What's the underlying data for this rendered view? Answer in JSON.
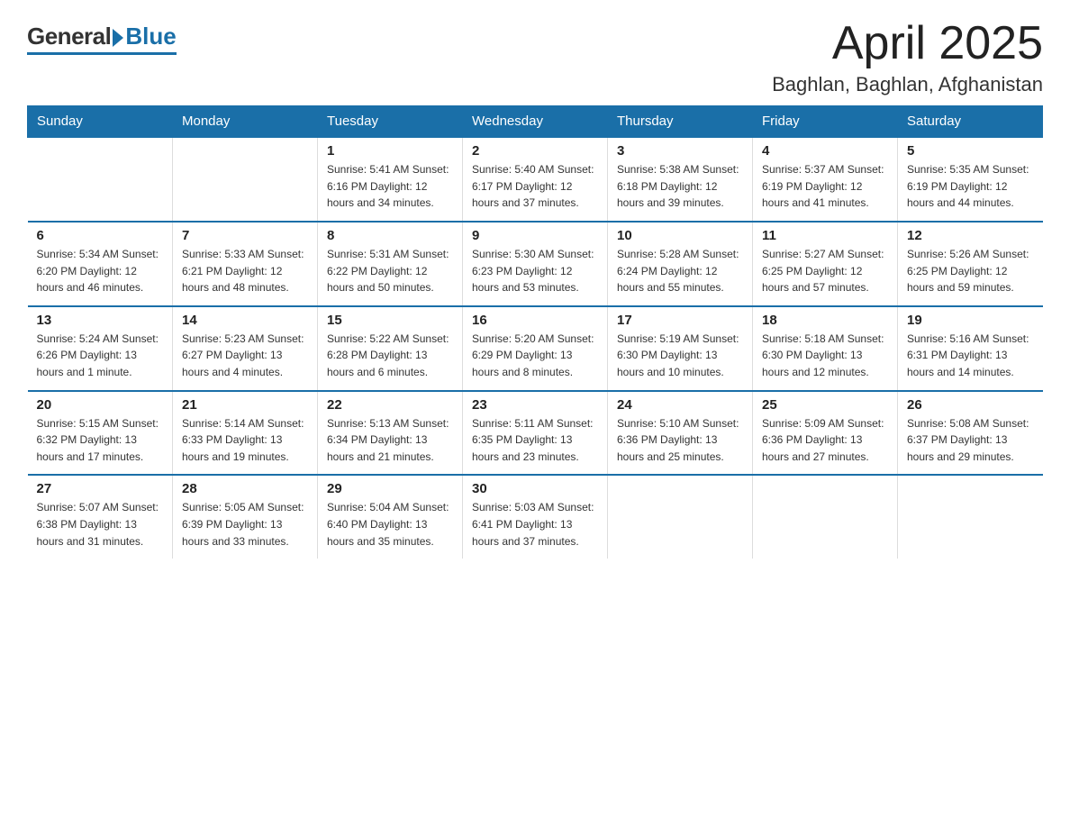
{
  "logo": {
    "general": "General",
    "blue": "Blue"
  },
  "title": "April 2025",
  "subtitle": "Baghlan, Baghlan, Afghanistan",
  "days_header": [
    "Sunday",
    "Monday",
    "Tuesday",
    "Wednesday",
    "Thursday",
    "Friday",
    "Saturday"
  ],
  "weeks": [
    [
      {
        "day": "",
        "info": ""
      },
      {
        "day": "",
        "info": ""
      },
      {
        "day": "1",
        "info": "Sunrise: 5:41 AM\nSunset: 6:16 PM\nDaylight: 12 hours\nand 34 minutes."
      },
      {
        "day": "2",
        "info": "Sunrise: 5:40 AM\nSunset: 6:17 PM\nDaylight: 12 hours\nand 37 minutes."
      },
      {
        "day": "3",
        "info": "Sunrise: 5:38 AM\nSunset: 6:18 PM\nDaylight: 12 hours\nand 39 minutes."
      },
      {
        "day": "4",
        "info": "Sunrise: 5:37 AM\nSunset: 6:19 PM\nDaylight: 12 hours\nand 41 minutes."
      },
      {
        "day": "5",
        "info": "Sunrise: 5:35 AM\nSunset: 6:19 PM\nDaylight: 12 hours\nand 44 minutes."
      }
    ],
    [
      {
        "day": "6",
        "info": "Sunrise: 5:34 AM\nSunset: 6:20 PM\nDaylight: 12 hours\nand 46 minutes."
      },
      {
        "day": "7",
        "info": "Sunrise: 5:33 AM\nSunset: 6:21 PM\nDaylight: 12 hours\nand 48 minutes."
      },
      {
        "day": "8",
        "info": "Sunrise: 5:31 AM\nSunset: 6:22 PM\nDaylight: 12 hours\nand 50 minutes."
      },
      {
        "day": "9",
        "info": "Sunrise: 5:30 AM\nSunset: 6:23 PM\nDaylight: 12 hours\nand 53 minutes."
      },
      {
        "day": "10",
        "info": "Sunrise: 5:28 AM\nSunset: 6:24 PM\nDaylight: 12 hours\nand 55 minutes."
      },
      {
        "day": "11",
        "info": "Sunrise: 5:27 AM\nSunset: 6:25 PM\nDaylight: 12 hours\nand 57 minutes."
      },
      {
        "day": "12",
        "info": "Sunrise: 5:26 AM\nSunset: 6:25 PM\nDaylight: 12 hours\nand 59 minutes."
      }
    ],
    [
      {
        "day": "13",
        "info": "Sunrise: 5:24 AM\nSunset: 6:26 PM\nDaylight: 13 hours\nand 1 minute."
      },
      {
        "day": "14",
        "info": "Sunrise: 5:23 AM\nSunset: 6:27 PM\nDaylight: 13 hours\nand 4 minutes."
      },
      {
        "day": "15",
        "info": "Sunrise: 5:22 AM\nSunset: 6:28 PM\nDaylight: 13 hours\nand 6 minutes."
      },
      {
        "day": "16",
        "info": "Sunrise: 5:20 AM\nSunset: 6:29 PM\nDaylight: 13 hours\nand 8 minutes."
      },
      {
        "day": "17",
        "info": "Sunrise: 5:19 AM\nSunset: 6:30 PM\nDaylight: 13 hours\nand 10 minutes."
      },
      {
        "day": "18",
        "info": "Sunrise: 5:18 AM\nSunset: 6:30 PM\nDaylight: 13 hours\nand 12 minutes."
      },
      {
        "day": "19",
        "info": "Sunrise: 5:16 AM\nSunset: 6:31 PM\nDaylight: 13 hours\nand 14 minutes."
      }
    ],
    [
      {
        "day": "20",
        "info": "Sunrise: 5:15 AM\nSunset: 6:32 PM\nDaylight: 13 hours\nand 17 minutes."
      },
      {
        "day": "21",
        "info": "Sunrise: 5:14 AM\nSunset: 6:33 PM\nDaylight: 13 hours\nand 19 minutes."
      },
      {
        "day": "22",
        "info": "Sunrise: 5:13 AM\nSunset: 6:34 PM\nDaylight: 13 hours\nand 21 minutes."
      },
      {
        "day": "23",
        "info": "Sunrise: 5:11 AM\nSunset: 6:35 PM\nDaylight: 13 hours\nand 23 minutes."
      },
      {
        "day": "24",
        "info": "Sunrise: 5:10 AM\nSunset: 6:36 PM\nDaylight: 13 hours\nand 25 minutes."
      },
      {
        "day": "25",
        "info": "Sunrise: 5:09 AM\nSunset: 6:36 PM\nDaylight: 13 hours\nand 27 minutes."
      },
      {
        "day": "26",
        "info": "Sunrise: 5:08 AM\nSunset: 6:37 PM\nDaylight: 13 hours\nand 29 minutes."
      }
    ],
    [
      {
        "day": "27",
        "info": "Sunrise: 5:07 AM\nSunset: 6:38 PM\nDaylight: 13 hours\nand 31 minutes."
      },
      {
        "day": "28",
        "info": "Sunrise: 5:05 AM\nSunset: 6:39 PM\nDaylight: 13 hours\nand 33 minutes."
      },
      {
        "day": "29",
        "info": "Sunrise: 5:04 AM\nSunset: 6:40 PM\nDaylight: 13 hours\nand 35 minutes."
      },
      {
        "day": "30",
        "info": "Sunrise: 5:03 AM\nSunset: 6:41 PM\nDaylight: 13 hours\nand 37 minutes."
      },
      {
        "day": "",
        "info": ""
      },
      {
        "day": "",
        "info": ""
      },
      {
        "day": "",
        "info": ""
      }
    ]
  ]
}
